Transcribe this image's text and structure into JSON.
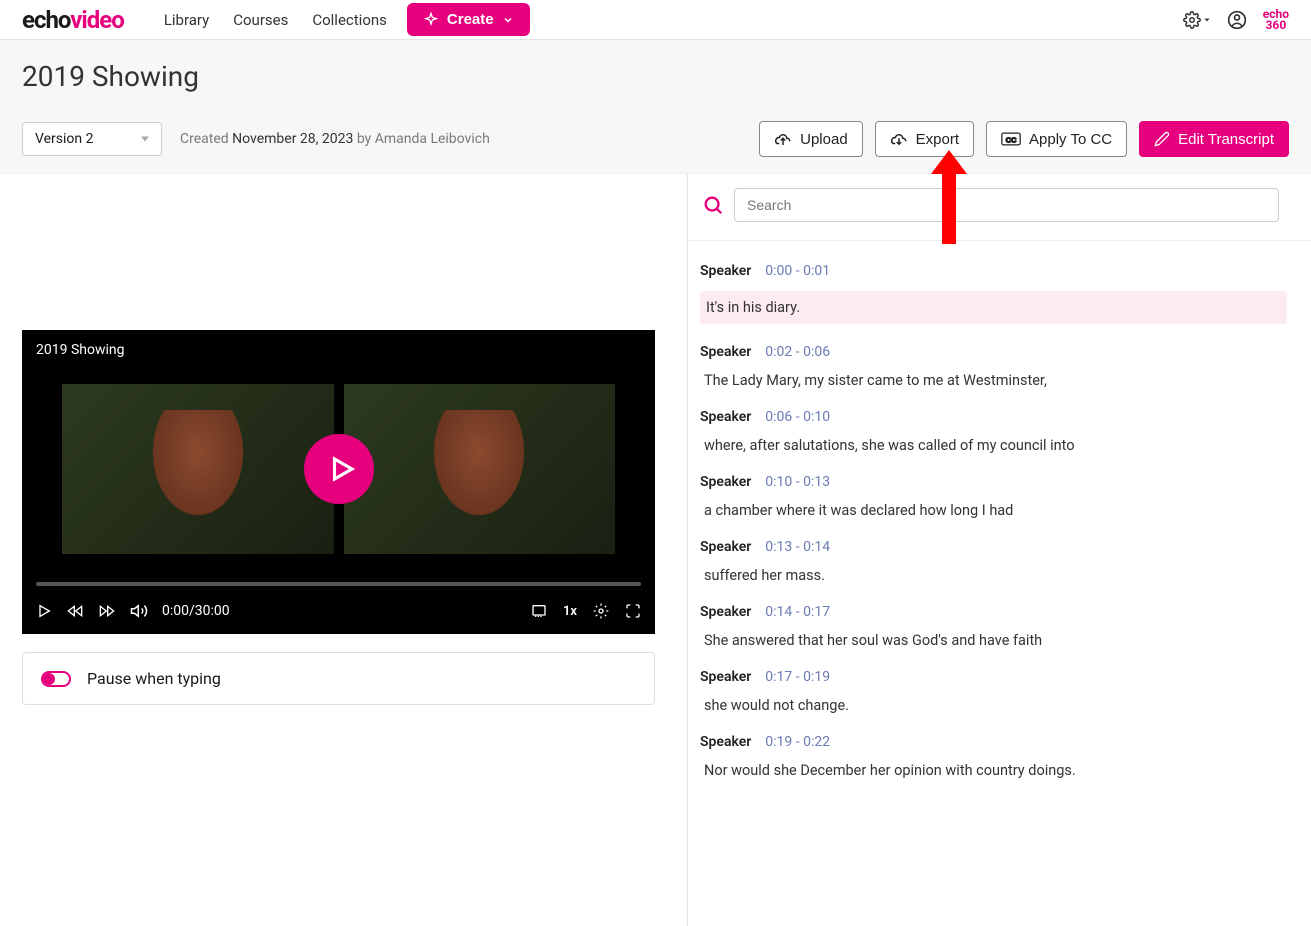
{
  "brand": {
    "part1": "echo",
    "part2": "video",
    "echo360_top": "echo",
    "echo360_bottom": "360"
  },
  "nav": {
    "library": "Library",
    "courses": "Courses",
    "collections": "Collections",
    "create": "Create"
  },
  "page": {
    "title": "2019 Showing",
    "version": "Version 2",
    "created_prefix": "Created ",
    "created_date": "November 28, 2023",
    "created_by_prefix": " by ",
    "created_author": "Amanda Leibovich"
  },
  "actions": {
    "upload": "Upload",
    "export": "Export",
    "apply_cc": "Apply To CC",
    "edit": "Edit Transcript"
  },
  "video": {
    "title": "2019 Showing",
    "time": "0:00/30:00",
    "speed": "1x"
  },
  "pause_label": "Pause when typing",
  "search": {
    "placeholder": "Search"
  },
  "transcript": [
    {
      "speaker": "Speaker",
      "time": "0:00 - 0:01",
      "text": "It's in his diary.",
      "highlight": true
    },
    {
      "speaker": "Speaker",
      "time": "0:02 - 0:06",
      "text": "The Lady Mary, my sister came to me at Westminster,"
    },
    {
      "speaker": "Speaker",
      "time": "0:06 - 0:10",
      "text": "where, after salutations, she was called of my council into"
    },
    {
      "speaker": "Speaker",
      "time": "0:10 - 0:13",
      "text": "a chamber where it was declared how long I had"
    },
    {
      "speaker": "Speaker",
      "time": "0:13 - 0:14",
      "text": "suffered her mass."
    },
    {
      "speaker": "Speaker",
      "time": "0:14 - 0:17",
      "text": "She answered that her soul was God's and have faith"
    },
    {
      "speaker": "Speaker",
      "time": "0:17 - 0:19",
      "text": "she would not change."
    },
    {
      "speaker": "Speaker",
      "time": "0:19 - 0:22",
      "text": "Nor would she December her opinion with country doings."
    }
  ]
}
